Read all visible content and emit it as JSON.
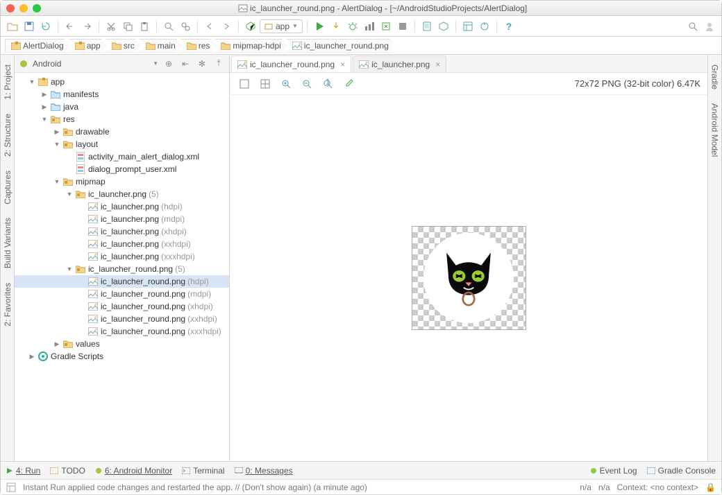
{
  "window": {
    "file_icon": "image",
    "title": "ic_launcher_round.png - AlertDialog - [~/AndroidStudioProjects/AlertDialog]"
  },
  "toolbar": {
    "run_target": "app"
  },
  "breadcrumb": [
    {
      "icon": "module",
      "label": "AlertDialog"
    },
    {
      "icon": "module",
      "label": "app"
    },
    {
      "icon": "folder",
      "label": "src"
    },
    {
      "icon": "folder",
      "label": "main"
    },
    {
      "icon": "folder",
      "label": "res"
    },
    {
      "icon": "folder",
      "label": "mipmap-hdpi"
    },
    {
      "icon": "image",
      "label": "ic_launcher_round.png"
    }
  ],
  "left_tabs": [
    "1: Project",
    "2: Structure",
    "Captures",
    "Build Variants",
    "2: Favorites"
  ],
  "right_tabs": [
    "Gradle",
    "Android Model"
  ],
  "project": {
    "header": "Android",
    "tree": [
      {
        "d": 0,
        "e": "open",
        "i": "module",
        "t": "app"
      },
      {
        "d": 1,
        "e": "closed",
        "i": "folderb",
        "t": "manifests"
      },
      {
        "d": 1,
        "e": "closed",
        "i": "folderb",
        "t": "java"
      },
      {
        "d": 1,
        "e": "open",
        "i": "foldero",
        "t": "res"
      },
      {
        "d": 2,
        "e": "closed",
        "i": "foldero",
        "t": "drawable"
      },
      {
        "d": 2,
        "e": "open",
        "i": "foldero",
        "t": "layout"
      },
      {
        "d": 3,
        "e": "",
        "i": "xml",
        "t": "activity_main_alert_dialog.xml"
      },
      {
        "d": 3,
        "e": "",
        "i": "xml",
        "t": "dialog_prompt_user.xml"
      },
      {
        "d": 2,
        "e": "open",
        "i": "foldero",
        "t": "mipmap"
      },
      {
        "d": 3,
        "e": "open",
        "i": "foldero",
        "t": "ic_launcher.png",
        "s": "(5)"
      },
      {
        "d": 4,
        "e": "",
        "i": "image",
        "t": "ic_launcher.png",
        "s": "(hdpi)"
      },
      {
        "d": 4,
        "e": "",
        "i": "image",
        "t": "ic_launcher.png",
        "s": "(mdpi)"
      },
      {
        "d": 4,
        "e": "",
        "i": "image",
        "t": "ic_launcher.png",
        "s": "(xhdpi)"
      },
      {
        "d": 4,
        "e": "",
        "i": "image",
        "t": "ic_launcher.png",
        "s": "(xxhdpi)"
      },
      {
        "d": 4,
        "e": "",
        "i": "image",
        "t": "ic_launcher.png",
        "s": "(xxxhdpi)"
      },
      {
        "d": 3,
        "e": "open",
        "i": "foldero",
        "t": "ic_launcher_round.png",
        "s": "(5)"
      },
      {
        "d": 4,
        "e": "",
        "i": "image",
        "t": "ic_launcher_round.png",
        "s": "(hdpi)",
        "sel": true
      },
      {
        "d": 4,
        "e": "",
        "i": "image",
        "t": "ic_launcher_round.png",
        "s": "(mdpi)"
      },
      {
        "d": 4,
        "e": "",
        "i": "image",
        "t": "ic_launcher_round.png",
        "s": "(xhdpi)"
      },
      {
        "d": 4,
        "e": "",
        "i": "image",
        "t": "ic_launcher_round.png",
        "s": "(xxhdpi)"
      },
      {
        "d": 4,
        "e": "",
        "i": "image",
        "t": "ic_launcher_round.png",
        "s": "(xxxhdpi)"
      },
      {
        "d": 2,
        "e": "closed",
        "i": "foldero",
        "t": "values"
      },
      {
        "d": 0,
        "e": "closed",
        "i": "gradle",
        "t": "Gradle Scripts"
      }
    ]
  },
  "editor": {
    "tabs": [
      {
        "icon": "image",
        "label": "ic_launcher_round.png",
        "active": true
      },
      {
        "icon": "image",
        "label": "ic_launcher.png",
        "active": false
      }
    ],
    "info": "72x72 PNG (32-bit color) 6.47K"
  },
  "bottom": {
    "items": [
      "4: Run",
      "TODO",
      "6: Android Monitor",
      "Terminal",
      "0: Messages"
    ],
    "right": [
      "Event Log",
      "Gradle Console"
    ]
  },
  "status": {
    "msg": "Instant Run applied code changes and restarted the app. // (Don't show again) (a minute ago)",
    "ctx1": "n/a",
    "ctx2": "n/a",
    "ctx3": "Context: <no context>"
  }
}
